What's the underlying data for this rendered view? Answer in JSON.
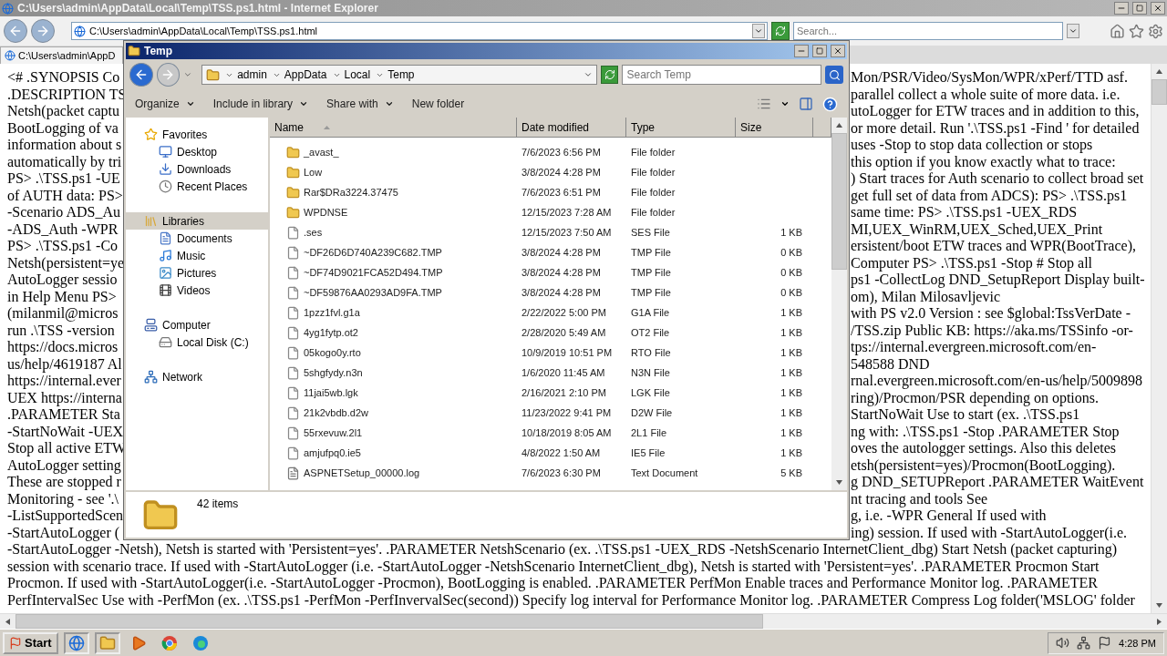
{
  "browser": {
    "title": "C:\\Users\\admin\\AppData\\Local\\Temp\\TSS.ps1.html - Internet Explorer",
    "address": "C:\\Users\\admin\\AppData\\Local\\Temp\\TSS.ps1.html",
    "search": {
      "placeholder": "Search..."
    },
    "tab": {
      "label": "C:\\Users\\admin\\AppD"
    }
  },
  "page_lines": [
    {
      "kind": "split",
      "left": "<# .SYNOPSIS Co",
      "right": "Mon/PSR/Video/SysMon/WPR/xPerf/TTD asf."
    },
    {
      "kind": "split",
      "left": ".DESCRIPTION TS",
      "right": "parallel collect a whole suite of more data. i.e."
    },
    {
      "kind": "split",
      "left": "Netsh(packet captu",
      "right": "utoLogger for ETW traces and in addition to this,"
    },
    {
      "kind": "split",
      "left": "BootLogging of va",
      "right": "or more detail. Run '.\\TSS.ps1 -Find ' for detailed"
    },
    {
      "kind": "split",
      "left": "information about s",
      "right": "uses -Stop to stop data collection or stops"
    },
    {
      "kind": "split",
      "left": "automatically by tri",
      "right": "this option if you know exactly what to trace:"
    },
    {
      "kind": "split",
      "left": "PS> .\\TSS.ps1 -UE",
      "right": ") Start traces for Auth scenario to collect broad set"
    },
    {
      "kind": "split",
      "left": "of AUTH data: PS>",
      "right": "get full set of data from ADCS): PS> .\\TSS.ps1"
    },
    {
      "kind": "split",
      "left": "-Scenario ADS_Au",
      "right": "same time: PS> .\\TSS.ps1 -UEX_RDS"
    },
    {
      "kind": "split",
      "left": "-ADS_Auth -WPR",
      "right": "MI,UEX_WinRM,UEX_Sched,UEX_Print"
    },
    {
      "kind": "split",
      "left": "PS> .\\TSS.ps1 -Co",
      "right": "ersistent/boot ETW traces and WPR(BootTrace),"
    },
    {
      "kind": "split",
      "left": "Netsh(persistent=ye",
      "right": "Computer PS> .\\TSS.ps1 -Stop # Stop all"
    },
    {
      "kind": "split",
      "left": "AutoLogger sessio",
      "right": "ps1 -CollectLog DND_SetupReport Display built-"
    },
    {
      "kind": "split",
      "left": "in Help Menu PS>",
      "right": "om), Milan Milosavljevic"
    },
    {
      "kind": "split",
      "left": "(milanmil@micros",
      "right": "with PS v2.0 Version : see $global:TssVerDate -"
    },
    {
      "kind": "split",
      "left": "run .\\TSS -version",
      "right": "/TSS.zip Public KB: https://aka.ms/TSSinfo -or-"
    },
    {
      "kind": "split",
      "left": "https://docs.micros",
      "right": "tps://internal.evergreen.microsoft.com/en-"
    },
    {
      "kind": "split",
      "left": "us/help/4619187 Al",
      "right": "548588 DND"
    },
    {
      "kind": "split",
      "left": "https://internal.ever",
      "right": "rnal.evergreen.microsoft.com/en-us/help/5009898"
    },
    {
      "kind": "split",
      "left": "UEX https://interna",
      "right": "ring)/Procmon/PSR depending on options."
    },
    {
      "kind": "split",
      "left": ".PARAMETER Sta",
      "right": "StartNoWait Use to start (ex. .\\TSS.ps1"
    },
    {
      "kind": "split",
      "left": "-StartNoWait -UEX",
      "right": "ng with: .\\TSS.ps1 -Stop .PARAMETER Stop"
    },
    {
      "kind": "split",
      "left": "Stop all active ETW",
      "right": "oves the autologger settings. Also this deletes"
    },
    {
      "kind": "split",
      "left": "AutoLogger setting",
      "right": "etsh(persistent=yes)/Procmon(BootLogging)."
    },
    {
      "kind": "split",
      "left": "These are stopped r",
      "right": "g DND_SETUPReport .PARAMETER WaitEvent"
    },
    {
      "kind": "split",
      "left": "Monitoring - see '.\\",
      "right": "nt tracing and tools See"
    },
    {
      "kind": "split",
      "left": "-ListSupportedScen",
      "right": "g, i.e. -WPR General If used with"
    },
    {
      "kind": "split",
      "left": "-StartAutoLogger (",
      "right": "ing) session. If used with -StartAutoLogger(i.e."
    },
    {
      "kind": "full",
      "text": "-StartAutoLogger -Netsh), Netsh is started with 'Persistent=yes'. .PARAMETER NetshScenario (ex. .\\TSS.ps1 -UEX_RDS -NetshScenario InternetClient_dbg) Start Netsh (packet capturing)"
    },
    {
      "kind": "full",
      "text": "session with scenario trace. If used with -StartAutoLogger (i.e. -StartAutoLogger -NetshScenario InternetClient_dbg), Netsh is started with 'Persistent=yes'. .PARAMETER Procmon Start"
    },
    {
      "kind": "full",
      "text": "Procmon. If used with -StartAutoLogger(i.e. -StartAutoLogger -Procmon), BootLogging is enabled. .PARAMETER PerfMon Enable traces and Performance Monitor log. .PARAMETER"
    },
    {
      "kind": "full",
      "text": "PerfIntervalSec Use with -PerfMon (ex. .\\TSS.ps1 -PerfMon -PerfInvervalSec(second)) Specify log interval for Performance Monitor log. .PARAMETER Compress Log folder('MSLOG' folder"
    }
  ],
  "explorer": {
    "title": "Temp",
    "breadcrumb": [
      "admin",
      "AppData",
      "Local",
      "Temp"
    ],
    "search": {
      "placeholder": "Search Temp"
    },
    "toolbar": [
      {
        "label": "Organize",
        "dropdown": true
      },
      {
        "label": "Include in library",
        "dropdown": true
      },
      {
        "label": "Share with",
        "dropdown": true
      },
      {
        "label": "New folder",
        "dropdown": false
      }
    ],
    "sidebar": [
      {
        "label": "Favorites",
        "kind": "favorites",
        "selected": false,
        "children": [
          {
            "label": "Desktop",
            "kind": "desktop",
            "selected": false
          },
          {
            "label": "Downloads",
            "kind": "downloads",
            "selected": false
          },
          {
            "label": "Recent Places",
            "kind": "recent",
            "selected": false
          }
        ]
      },
      {
        "label": "Libraries",
        "kind": "libraries",
        "selected": true,
        "children": [
          {
            "label": "Documents",
            "kind": "documents",
            "selected": false
          },
          {
            "label": "Music",
            "kind": "music",
            "selected": false
          },
          {
            "label": "Pictures",
            "kind": "pictures",
            "selected": false
          },
          {
            "label": "Videos",
            "kind": "videos",
            "selected": false
          }
        ]
      },
      {
        "label": "Computer",
        "kind": "computer",
        "selected": false,
        "children": [
          {
            "label": "Local Disk (C:)",
            "kind": "disk",
            "selected": false
          }
        ]
      },
      {
        "label": "Network",
        "kind": "network",
        "selected": false
      }
    ],
    "columns": [
      "Name",
      "Date modified",
      "Type",
      "Size"
    ],
    "files": [
      {
        "name": "_avast_",
        "date": "7/6/2023 6:56 PM",
        "type": "File folder",
        "kind": "folder"
      },
      {
        "name": "Low",
        "date": "3/8/2024 4:28 PM",
        "type": "File folder",
        "kind": "folder"
      },
      {
        "name": "Rar$DRa3224.37475",
        "date": "7/6/2023 6:51 PM",
        "type": "File folder",
        "kind": "folder"
      },
      {
        "name": "WPDNSE",
        "date": "12/15/2023 7:28 AM",
        "type": "File folder",
        "kind": "folder"
      },
      {
        "name": ".ses",
        "date": "12/15/2023 7:50 AM",
        "type": "SES File",
        "size": "1 KB",
        "kind": "file"
      },
      {
        "name": "~DF26D6D740A239C682.TMP",
        "date": "3/8/2024 4:28 PM",
        "type": "TMP File",
        "size": "0 KB",
        "kind": "file"
      },
      {
        "name": "~DF74D9021FCA52D494.TMP",
        "date": "3/8/2024 4:28 PM",
        "type": "TMP File",
        "size": "0 KB",
        "kind": "file"
      },
      {
        "name": "~DF59876AA0293AD9FA.TMP",
        "date": "3/8/2024 4:28 PM",
        "type": "TMP File",
        "size": "0 KB",
        "kind": "file"
      },
      {
        "name": "1pzz1fvl.g1a",
        "date": "2/22/2022 5:00 PM",
        "type": "G1A File",
        "size": "1 KB",
        "kind": "file"
      },
      {
        "name": "4yg1fytp.ot2",
        "date": "2/28/2020 5:49 AM",
        "type": "OT2 File",
        "size": "1 KB",
        "kind": "file"
      },
      {
        "name": "05kogo0y.rto",
        "date": "10/9/2019 10:51 PM",
        "type": "RTO File",
        "size": "1 KB",
        "kind": "file"
      },
      {
        "name": "5shgfydy.n3n",
        "date": "1/6/2020 11:45 AM",
        "type": "N3N File",
        "size": "1 KB",
        "kind": "file"
      },
      {
        "name": "11jai5wb.lgk",
        "date": "2/16/2021 2:10 PM",
        "type": "LGK File",
        "size": "1 KB",
        "kind": "file"
      },
      {
        "name": "21k2vbdb.d2w",
        "date": "11/23/2022 9:41 PM",
        "type": "D2W File",
        "size": "1 KB",
        "kind": "file"
      },
      {
        "name": "55rxevuw.2l1",
        "date": "10/18/2019 8:05 AM",
        "type": "2L1 File",
        "size": "1 KB",
        "kind": "file"
      },
      {
        "name": "amjufpq0.ie5",
        "date": "4/8/2022 1:50 AM",
        "type": "IE5 File",
        "size": "1 KB",
        "kind": "file"
      },
      {
        "name": "ASPNETSetup_00000.log",
        "date": "7/6/2023 6:30 PM",
        "type": "Text Document",
        "size": "5 KB",
        "kind": "text"
      }
    ],
    "status": "42 items"
  },
  "taskbar": {
    "start": "Start",
    "apps": [
      {
        "kind": "ie"
      },
      {
        "kind": "explorer"
      },
      {
        "kind": "media"
      },
      {
        "kind": "chrome"
      },
      {
        "kind": "edge"
      }
    ],
    "clock": "4:28 PM"
  }
}
